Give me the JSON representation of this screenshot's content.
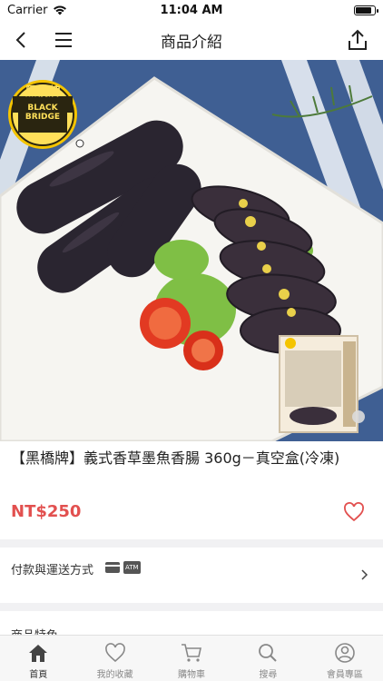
{
  "status_bar": {
    "carrier": "Carrier",
    "time": "11:04 AM"
  },
  "nav": {
    "title": "商品介紹"
  },
  "product": {
    "image_alt_brand": "黑橋牌",
    "brand_logo_line1": "黑橋牌",
    "brand_logo_line2": "BLACK",
    "brand_logo_line3": "BRIDGE",
    "title": "【黑橋牌】義式香草墨魚香腸 360g－真空盒(冷凍)",
    "price": "NT$250"
  },
  "payment": {
    "label": "付款與運送方式",
    "atm_badge": "ATM"
  },
  "features": {
    "label": "商品特色"
  },
  "tabs": [
    {
      "label": "首頁",
      "icon": "home-icon",
      "active": true
    },
    {
      "label": "我的收藏",
      "icon": "heart-icon",
      "active": false
    },
    {
      "label": "購物車",
      "icon": "cart-icon",
      "active": false
    },
    {
      "label": "搜尋",
      "icon": "search-icon",
      "active": false
    },
    {
      "label": "會員專區",
      "icon": "user-icon",
      "active": false
    }
  ],
  "colors": {
    "price": "#e2504f",
    "accent_heart": "#e2504f",
    "logo_yellow": "#f4c400"
  }
}
